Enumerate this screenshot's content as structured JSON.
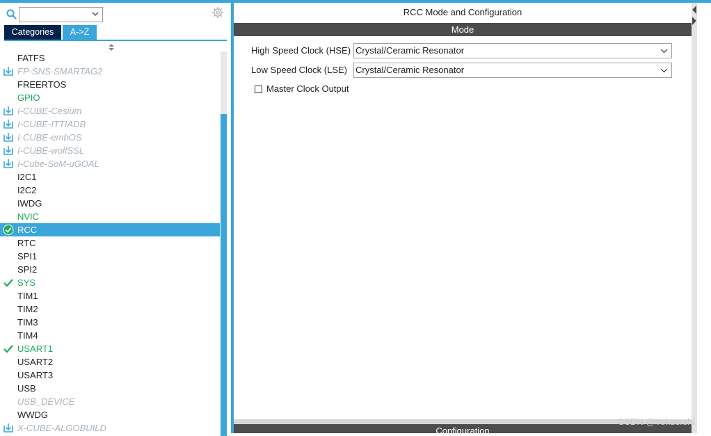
{
  "left_panel": {
    "search": {
      "value": ""
    },
    "tabs": [
      {
        "label": "Categories",
        "active": false
      },
      {
        "label": "A->Z",
        "active": true
      }
    ],
    "items": [
      {
        "label": "FATFS",
        "state": "normal",
        "icon": "none"
      },
      {
        "label": "FP-SNS-SMARTAG2",
        "state": "disabled",
        "icon": "download-icon"
      },
      {
        "label": "FREERTOS",
        "state": "normal",
        "icon": "none"
      },
      {
        "label": "GPIO",
        "state": "green",
        "icon": "none"
      },
      {
        "label": "I-CUBE-Cesium",
        "state": "disabled",
        "icon": "download-icon"
      },
      {
        "label": "I-CUBE-ITTIADB",
        "state": "disabled",
        "icon": "download-icon"
      },
      {
        "label": "I-CUBE-embOS",
        "state": "disabled",
        "icon": "download-icon"
      },
      {
        "label": "I-CUBE-wolfSSL",
        "state": "disabled",
        "icon": "download-icon"
      },
      {
        "label": "I-Cube-SoM-uGOAL",
        "state": "disabled",
        "icon": "download-icon"
      },
      {
        "label": "I2C1",
        "state": "normal",
        "icon": "none"
      },
      {
        "label": "I2C2",
        "state": "normal",
        "icon": "none"
      },
      {
        "label": "IWDG",
        "state": "normal",
        "icon": "none"
      },
      {
        "label": "NVIC",
        "state": "green",
        "icon": "none"
      },
      {
        "label": "RCC",
        "state": "selected",
        "icon": "check-circle-icon"
      },
      {
        "label": "RTC",
        "state": "normal",
        "icon": "none"
      },
      {
        "label": "SPI1",
        "state": "normal",
        "icon": "none"
      },
      {
        "label": "SPI2",
        "state": "normal",
        "icon": "none"
      },
      {
        "label": "SYS",
        "state": "green",
        "icon": "check-icon"
      },
      {
        "label": "TIM1",
        "state": "normal",
        "icon": "none"
      },
      {
        "label": "TIM2",
        "state": "normal",
        "icon": "none"
      },
      {
        "label": "TIM3",
        "state": "normal",
        "icon": "none"
      },
      {
        "label": "TIM4",
        "state": "normal",
        "icon": "none"
      },
      {
        "label": "USART1",
        "state": "green",
        "icon": "check-icon"
      },
      {
        "label": "USART2",
        "state": "normal",
        "icon": "none"
      },
      {
        "label": "USART3",
        "state": "normal",
        "icon": "none"
      },
      {
        "label": "USB",
        "state": "normal",
        "icon": "none"
      },
      {
        "label": "USB_DEVICE",
        "state": "disabled",
        "icon": "none"
      },
      {
        "label": "WWDG",
        "state": "normal",
        "icon": "none"
      },
      {
        "label": "X-CUBE-ALGOBUILD",
        "state": "disabled",
        "icon": "download-icon"
      }
    ]
  },
  "right_panel": {
    "title": "RCC Mode and Configuration",
    "mode_header": "Mode",
    "hse": {
      "label": "High Speed Clock (HSE)",
      "value": "Crystal/Ceramic Resonator"
    },
    "lse": {
      "label": "Low Speed Clock (LSE)",
      "value": "Crystal/Ceramic Resonator"
    },
    "mco": {
      "label": "Master Clock Output",
      "checked": false
    },
    "config_header": "Configuration"
  },
  "watermark": "CSDN @Yokuershi",
  "colors": {
    "accent": "#3ba6dc",
    "navy": "#03234b",
    "green": "#1ea85a",
    "disabled": "#a9b4bd",
    "bar_dark": "#4c4c4c"
  }
}
